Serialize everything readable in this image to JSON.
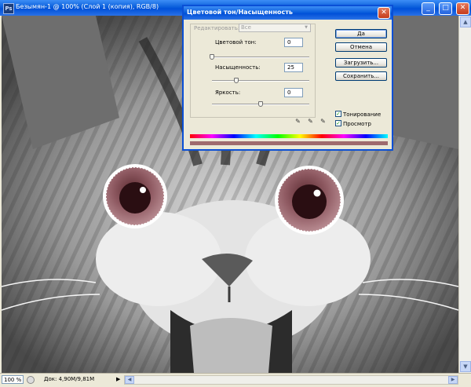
{
  "document": {
    "title": "Безымян-1 @ 100% (Слой 1 (копия), RGB/8)",
    "app_icon_letter": "Ps",
    "window_buttons": {
      "minimize": "_",
      "maximize": "□",
      "close": "✕"
    },
    "image_description_icon": "kitten-photo"
  },
  "status": {
    "zoom": "100 %",
    "doc_size": "Док: 4,90M/9,81M",
    "arrow": "▶"
  },
  "dialog": {
    "title": "Цветовой тон/Насыщенность",
    "close": "✕",
    "edit_label": "Редактировать:",
    "edit_value": "Все",
    "hue_label": "Цветовой тон:",
    "hue_value": "0",
    "saturation_label": "Насыщенность:",
    "saturation_value": "25",
    "lightness_label": "Яркость:",
    "lightness_value": "0",
    "buttons": {
      "ok": "Да",
      "cancel": "Отмена",
      "load": "Загрузить...",
      "save": "Сохранить..."
    },
    "colorize_label": "Тонирование",
    "colorize_checked": true,
    "preview_label": "Просмотр",
    "preview_checked": true,
    "check_mark": "✓",
    "sliders": {
      "hue": 0.0,
      "saturation": 0.25,
      "lightness": 0.5
    },
    "result_color": "#9e6a6e"
  }
}
